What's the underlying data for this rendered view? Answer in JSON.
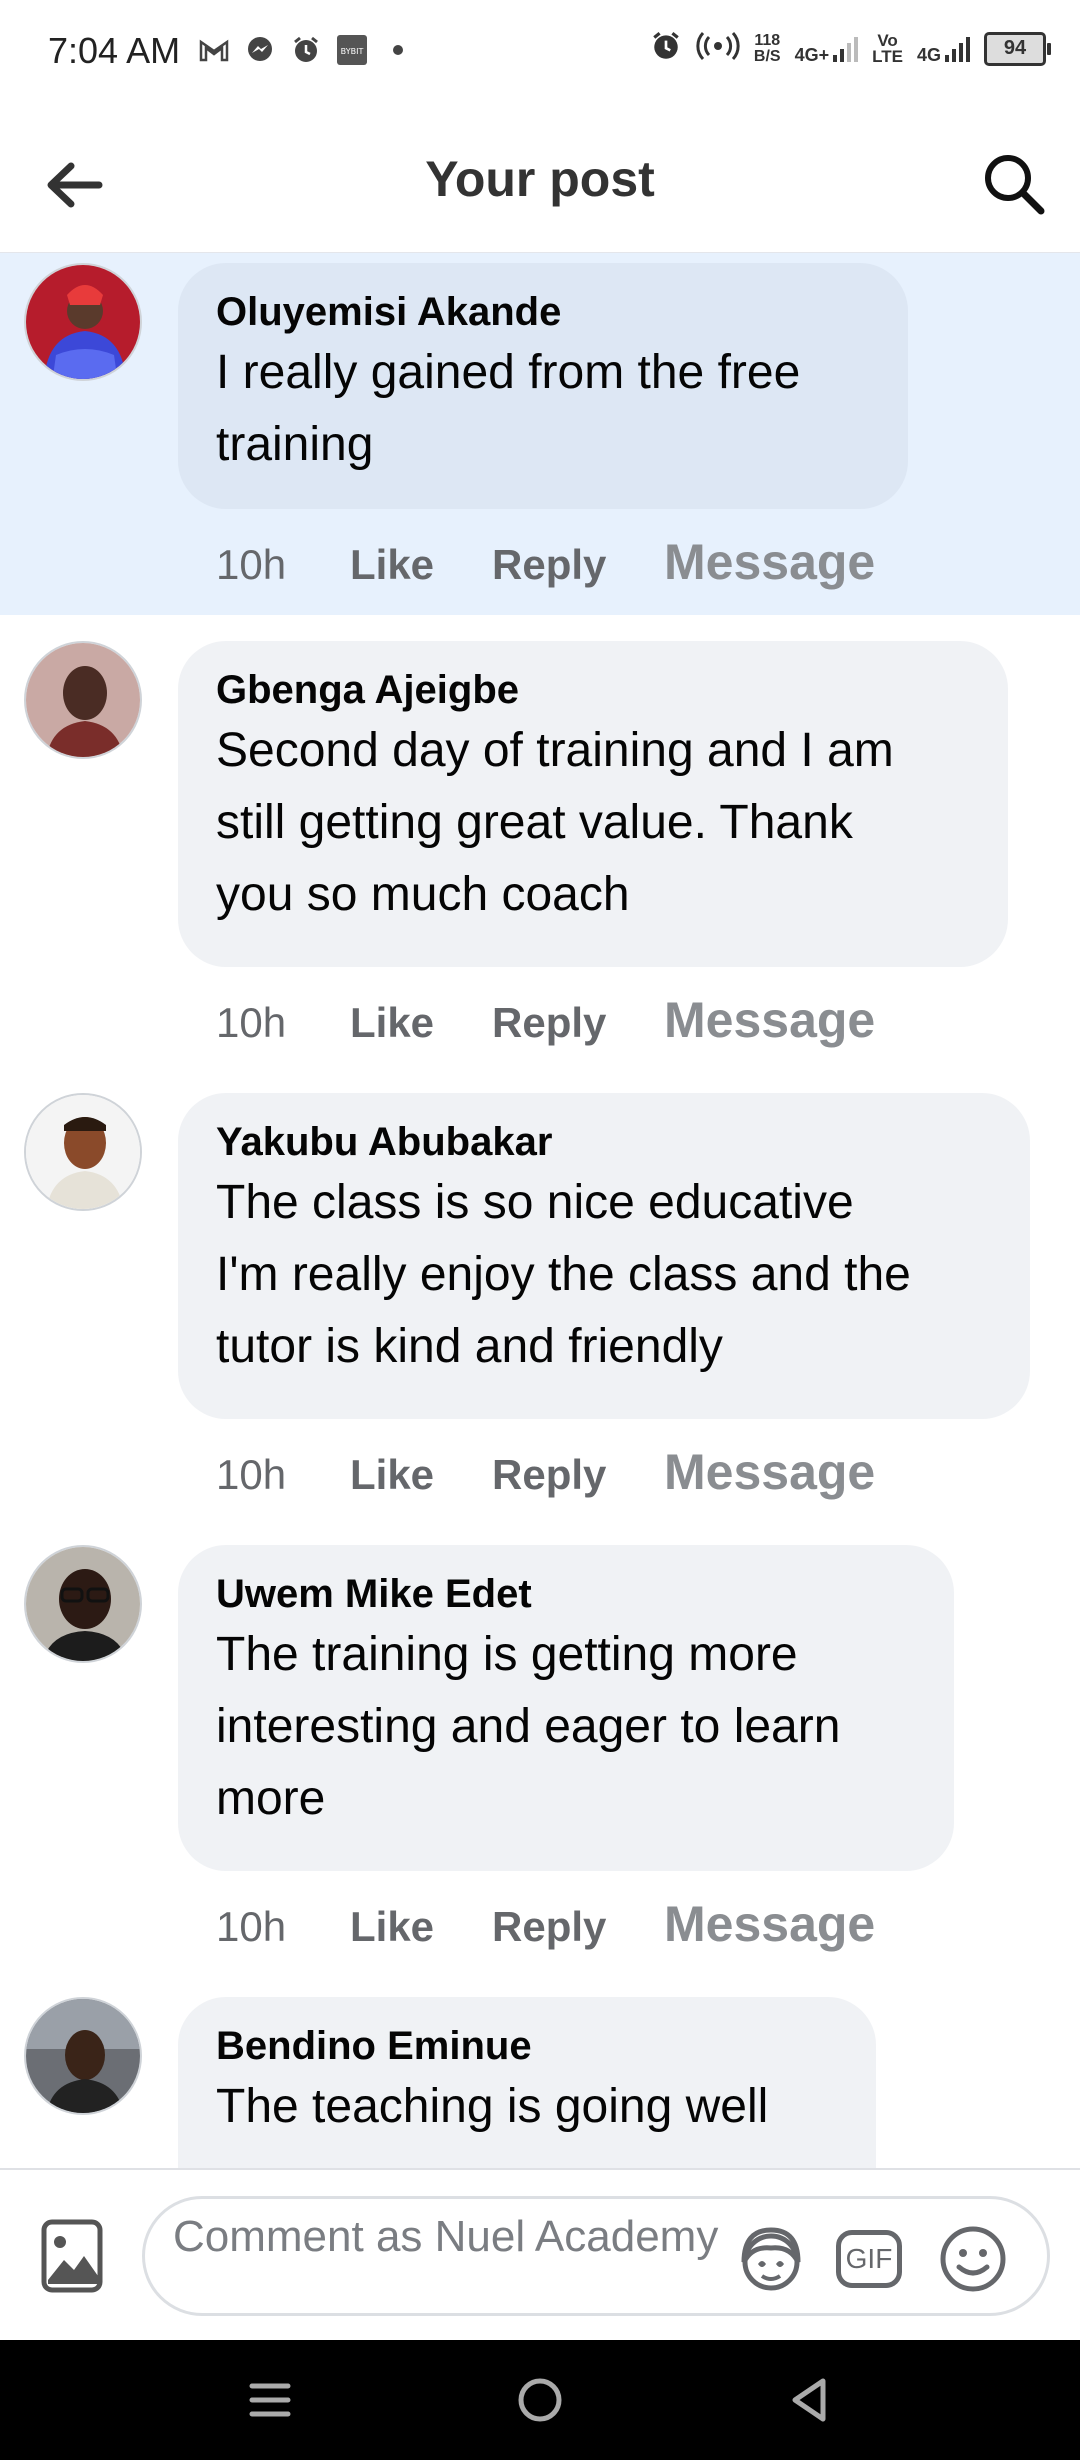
{
  "status_bar": {
    "time": "7:04 AM",
    "net_speed_value": "118",
    "net_speed_unit": "B/S",
    "signal_1": "4G+",
    "volte_top": "Vo",
    "volte_bottom": "LTE",
    "signal_2": "4G",
    "battery": "94",
    "left_icons": [
      "gmail-icon",
      "messenger-icon",
      "alarm-icon",
      "bybit-icon",
      "dot-icon"
    ],
    "right_icons": [
      "alarm-icon",
      "hotspot-icon",
      "signal-icon",
      "battery-icon"
    ]
  },
  "header": {
    "title": "Your post",
    "back_icon": "arrow-left-icon",
    "search_icon": "search-icon"
  },
  "comments": [
    {
      "author": "Oluyemisi Akande",
      "text_lines": [
        "I really gained from the free",
        "training"
      ],
      "time": "10h",
      "like": "Like",
      "reply": "Reply",
      "message": "Message",
      "highlighted": true
    },
    {
      "author": "Gbenga Ajeigbe",
      "text_lines": [
        "Second day of training and I am",
        "still getting great value. Thank",
        "you so much coach"
      ],
      "time": "10h",
      "like": "Like",
      "reply": "Reply",
      "message": "Message",
      "highlighted": false
    },
    {
      "author": "Yakubu Abubakar",
      "text_lines": [
        "The class is so nice educative",
        "I'm really enjoy the class and the",
        "tutor is kind and friendly"
      ],
      "time": "10h",
      "like": "Like",
      "reply": "Reply",
      "message": "Message",
      "highlighted": false
    },
    {
      "author": "Uwem Mike Edet",
      "text_lines": [
        "The training is getting more",
        "interesting and eager to learn",
        "more"
      ],
      "time": "10h",
      "like": "Like",
      "reply": "Reply",
      "message": "Message",
      "highlighted": false
    },
    {
      "author": "Bendino Eminue",
      "text_lines": [
        "The teaching is going well"
      ],
      "highlighted": false
    }
  ],
  "composer": {
    "placeholder": "Comment as Nuel Academy",
    "photo_icon": "photo-icon",
    "avatar_sticker_icon": "avatar-sticker-icon",
    "gif_label": "GIF",
    "emoji_icon": "emoji-icon"
  },
  "nav_bar": {
    "buttons": [
      "menu-icon",
      "home-icon",
      "back-icon"
    ]
  },
  "colors": {
    "highlight_bg": "#e7f1fd",
    "bubble_bg": "#f0f2f5",
    "secondary_text": "#65676b",
    "nav_bg": "#000000"
  }
}
